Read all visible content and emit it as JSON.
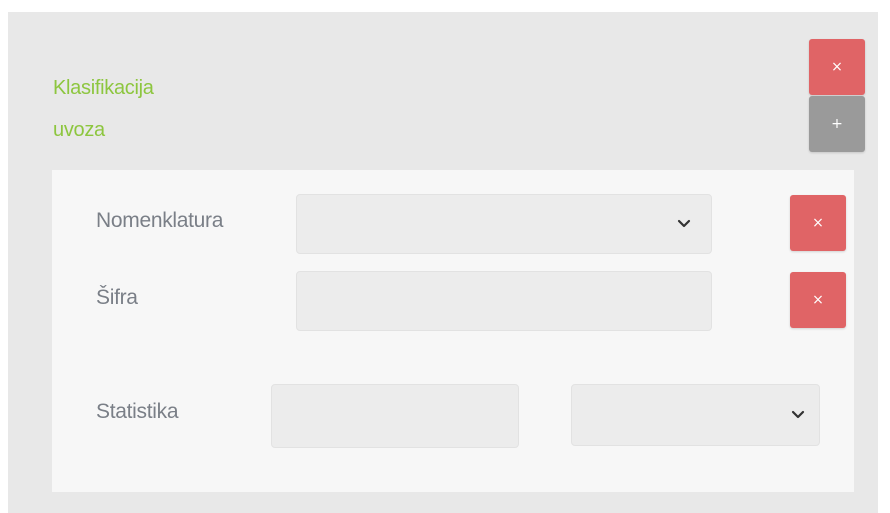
{
  "section": {
    "title_line1": "Klasifikacija",
    "title_line2": "uvoza",
    "remove_label": "×",
    "add_label": "+"
  },
  "form": {
    "nomenklatura": {
      "label": "Nomenklatura",
      "selected": "",
      "remove_label": "×"
    },
    "sifra": {
      "label": "Šifra",
      "value": "",
      "remove_label": "×"
    },
    "statistika": {
      "label": "Statistika",
      "value": "",
      "selected": ""
    }
  },
  "colors": {
    "accent_green": "#8dc63f",
    "danger": "#e06466",
    "secondary": "#9a9a9a",
    "panel_bg": "#e8e8e8",
    "card_bg": "#f7f7f7"
  },
  "icons": {
    "remove": "close-icon",
    "add": "plus-icon",
    "dropdown": "chevron-down-icon"
  }
}
